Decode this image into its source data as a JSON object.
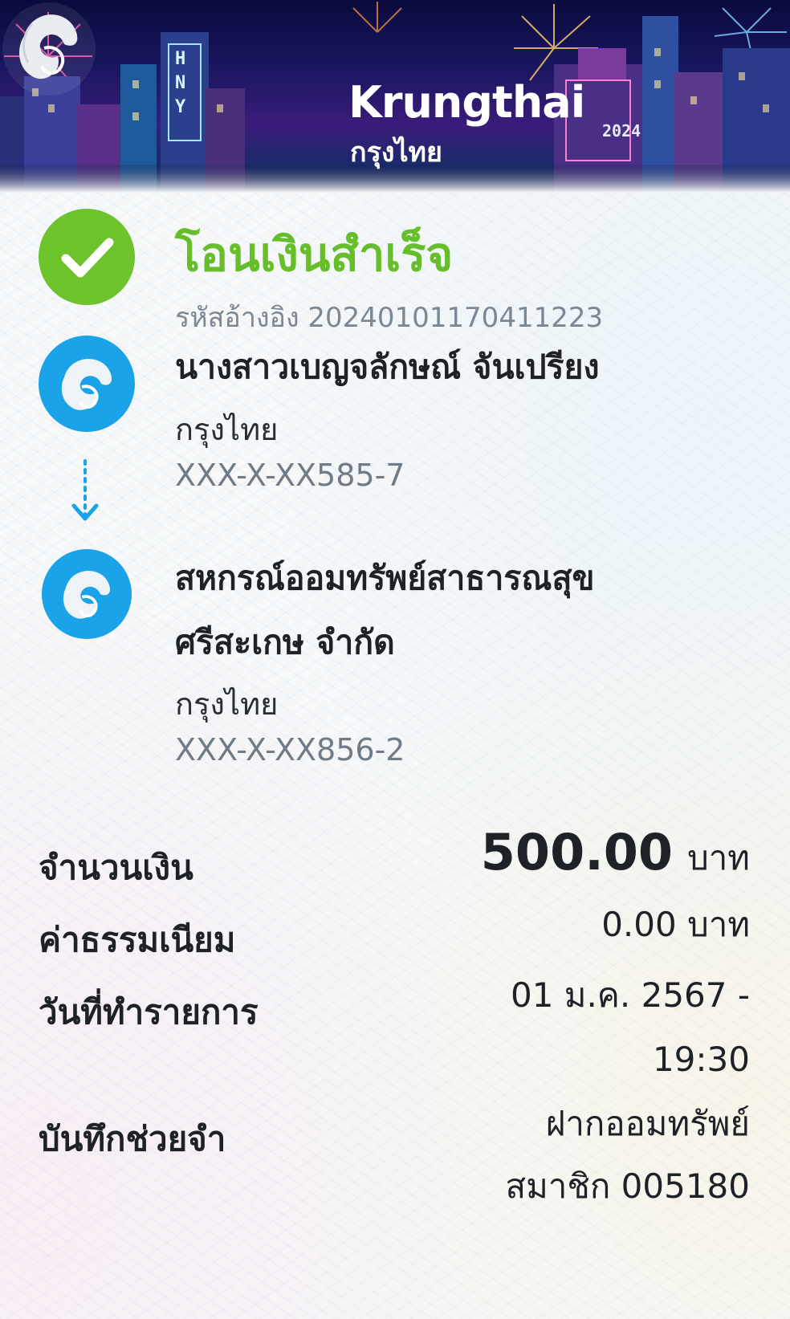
{
  "banner": {
    "brand_en": "Krungthai",
    "brand_th": "กรุงไทย",
    "year_sign": "2024",
    "building_sign": "HNY"
  },
  "transfer": {
    "status": "โอนเงินสำเร็จ",
    "reference": "รหัสอ้างอิง 20240101170411223"
  },
  "sender": {
    "name": "นางสาวเบญจลักษณ์ จันเปรียง",
    "bank": "กรุงไทย",
    "account": "XXX-X-XX585-7"
  },
  "receiver": {
    "name_line1": "สหกรณ์ออมทรัพย์สาธารณสุข",
    "name_line2": "ศรีสะเกษ จำกัด",
    "bank": "กรุงไทย",
    "account": "XXX-X-XX856-2"
  },
  "details": {
    "amount_label": "จำนวนเงิน",
    "amount_value": "500.00",
    "amount_unit": "บาท",
    "fee_label": "ค่าธรรมเนียม",
    "fee_value": "0.00 บาท",
    "date_label": "วันที่ทำรายการ",
    "date_line1": "01 ม.ค. 2567 -",
    "date_line2": "19:30",
    "memo_label": "บันทึกช่วยจำ",
    "memo_line1": "ฝากออมทรัพย์",
    "memo_line2": "สมาชิก 005180"
  },
  "colors": {
    "success_green": "#6cc32c",
    "bank_blue": "#1aa3e8",
    "account_gray": "#6f7b86"
  }
}
